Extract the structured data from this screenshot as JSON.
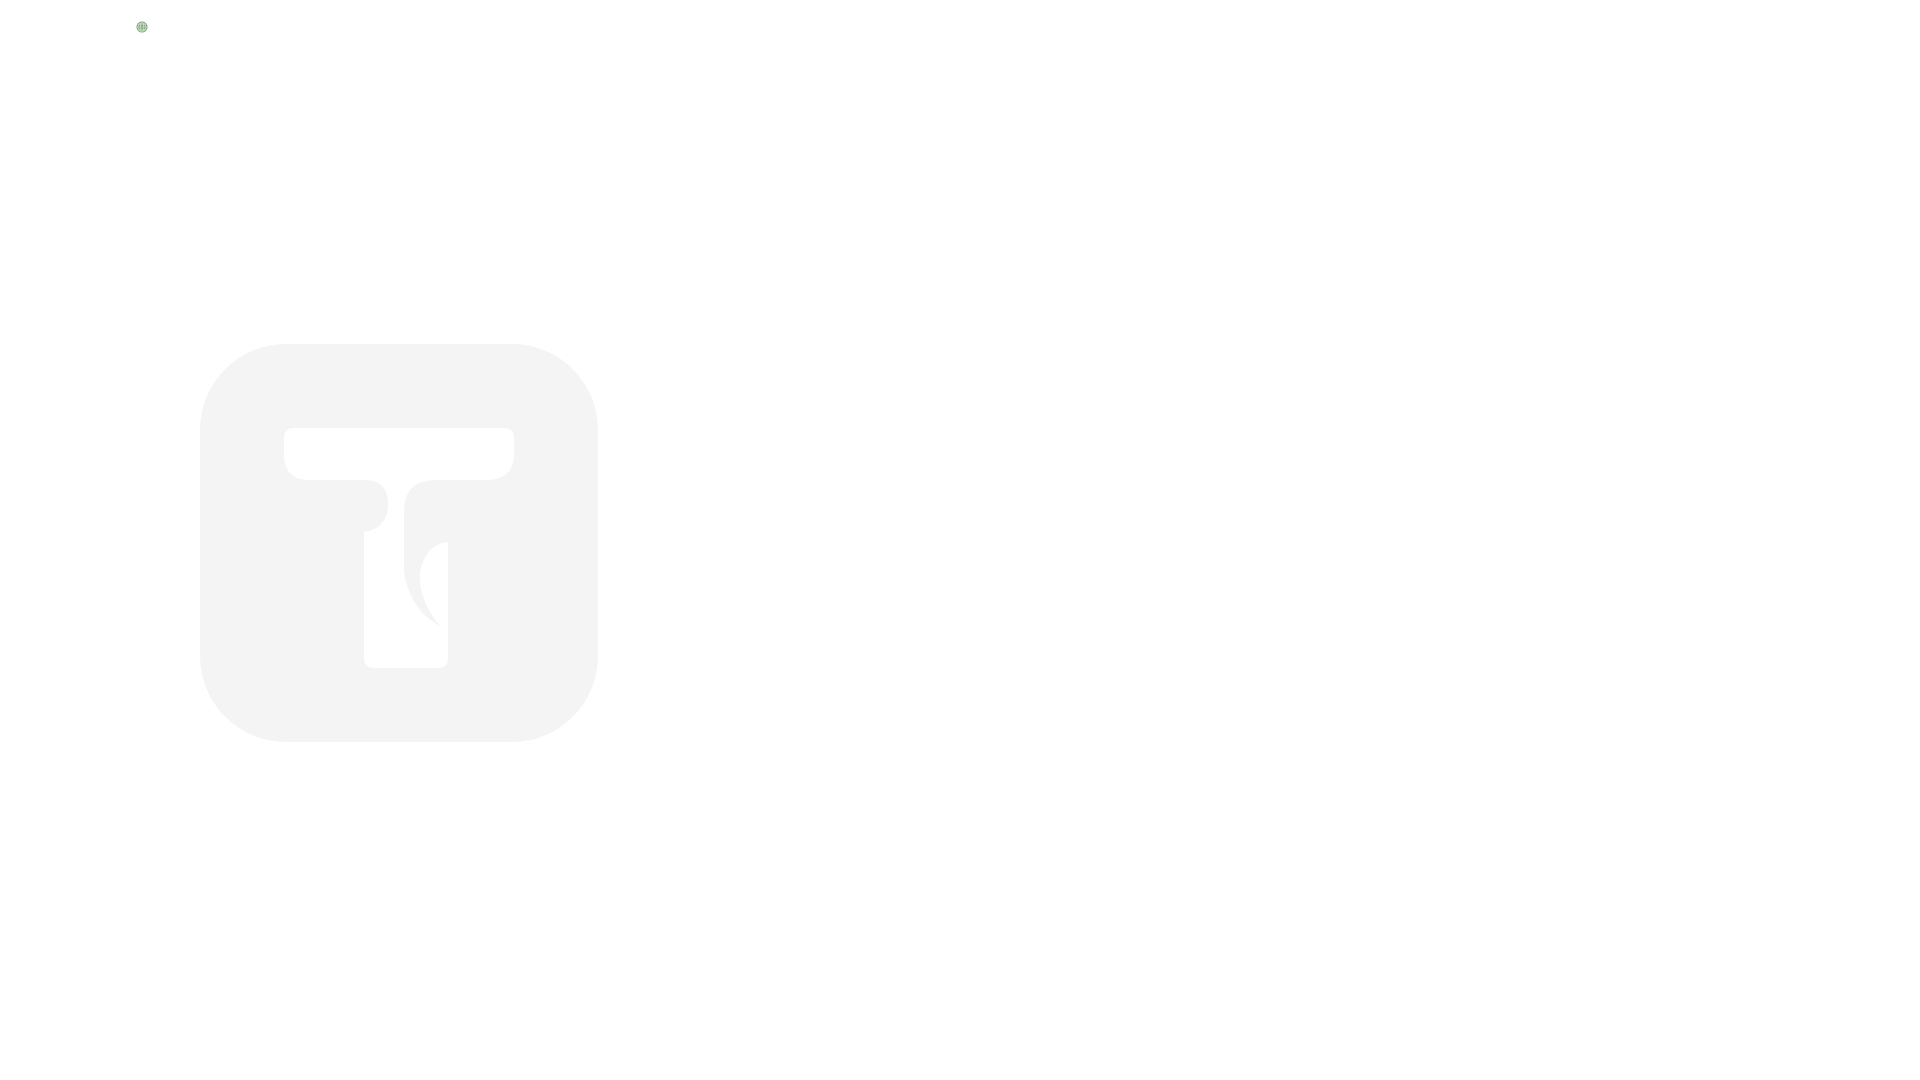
{
  "page": {
    "background_color": "#ffffff"
  },
  "status_indicator": {
    "icon": "globe-icon",
    "color": "#7aa77a"
  },
  "logo": {
    "icon": "t-logo-icon",
    "tile_color": "#f4f4f4",
    "glyph_color": "#ffffff"
  }
}
